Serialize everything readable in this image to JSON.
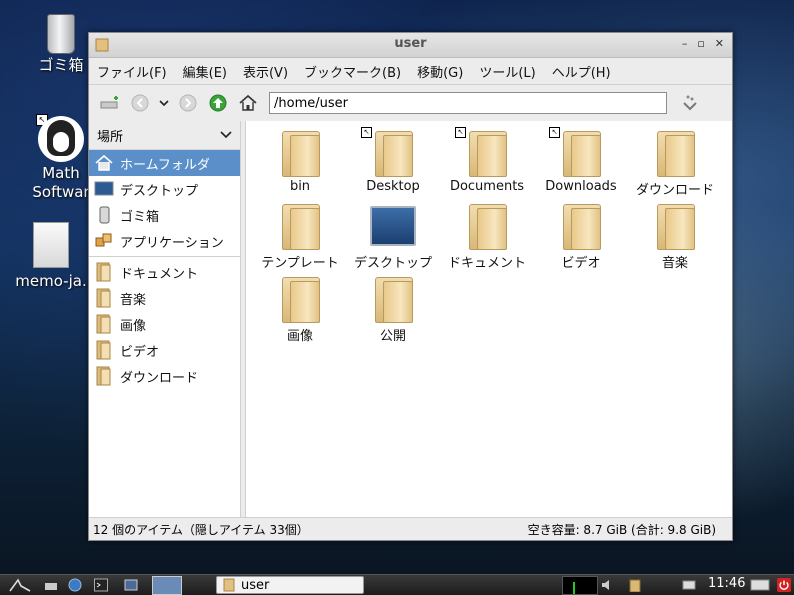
{
  "desktop": {
    "icons": [
      {
        "label": "ゴミ箱"
      },
      {
        "label": "Math Softwar"
      },
      {
        "label": "memo-ja."
      }
    ]
  },
  "window": {
    "title": "user",
    "menu": [
      "ファイル(F)",
      "編集(E)",
      "表示(V)",
      "ブックマーク(B)",
      "移動(G)",
      "ツール(L)",
      "ヘルプ(H)"
    ],
    "path": "/home/user",
    "sidebar": {
      "header": "場所",
      "items": [
        {
          "label": "ホームフォルダ",
          "icon": "home-icon",
          "selected": true
        },
        {
          "label": "デスクトップ",
          "icon": "desktop-icon"
        },
        {
          "label": "ゴミ箱",
          "icon": "trash-icon"
        },
        {
          "label": "アプリケーション",
          "icon": "applications-icon"
        },
        {
          "label": "ドキュメント",
          "icon": "folder-icon"
        },
        {
          "label": "音楽",
          "icon": "folder-icon"
        },
        {
          "label": "画像",
          "icon": "folder-icon"
        },
        {
          "label": "ビデオ",
          "icon": "folder-icon"
        },
        {
          "label": "ダウンロード",
          "icon": "folder-icon"
        }
      ]
    },
    "files": [
      {
        "label": "bin",
        "link": false
      },
      {
        "label": "Desktop",
        "link": true
      },
      {
        "label": "Documents",
        "link": true
      },
      {
        "label": "Downloads",
        "link": true
      },
      {
        "label": "ダウンロード",
        "link": false
      },
      {
        "label": "テンプレート",
        "link": false
      },
      {
        "label": "デスクトップ",
        "link": false,
        "type": "desktop"
      },
      {
        "label": "ドキュメント",
        "link": false
      },
      {
        "label": "ビデオ",
        "link": false
      },
      {
        "label": "音楽",
        "link": false
      },
      {
        "label": "画像",
        "link": false
      },
      {
        "label": "公開",
        "link": false
      }
    ],
    "status_left": "12 個のアイテム（隠しアイテム 33個）",
    "status_right": "空き容量: 8.7 GiB (合計: 9.8 GiB)"
  },
  "panel": {
    "task_label": "user",
    "clock": "11:46"
  },
  "colors": {
    "selection": "#5b8fc9",
    "up_arrow": "#3aa33a",
    "power": "#d22222"
  }
}
